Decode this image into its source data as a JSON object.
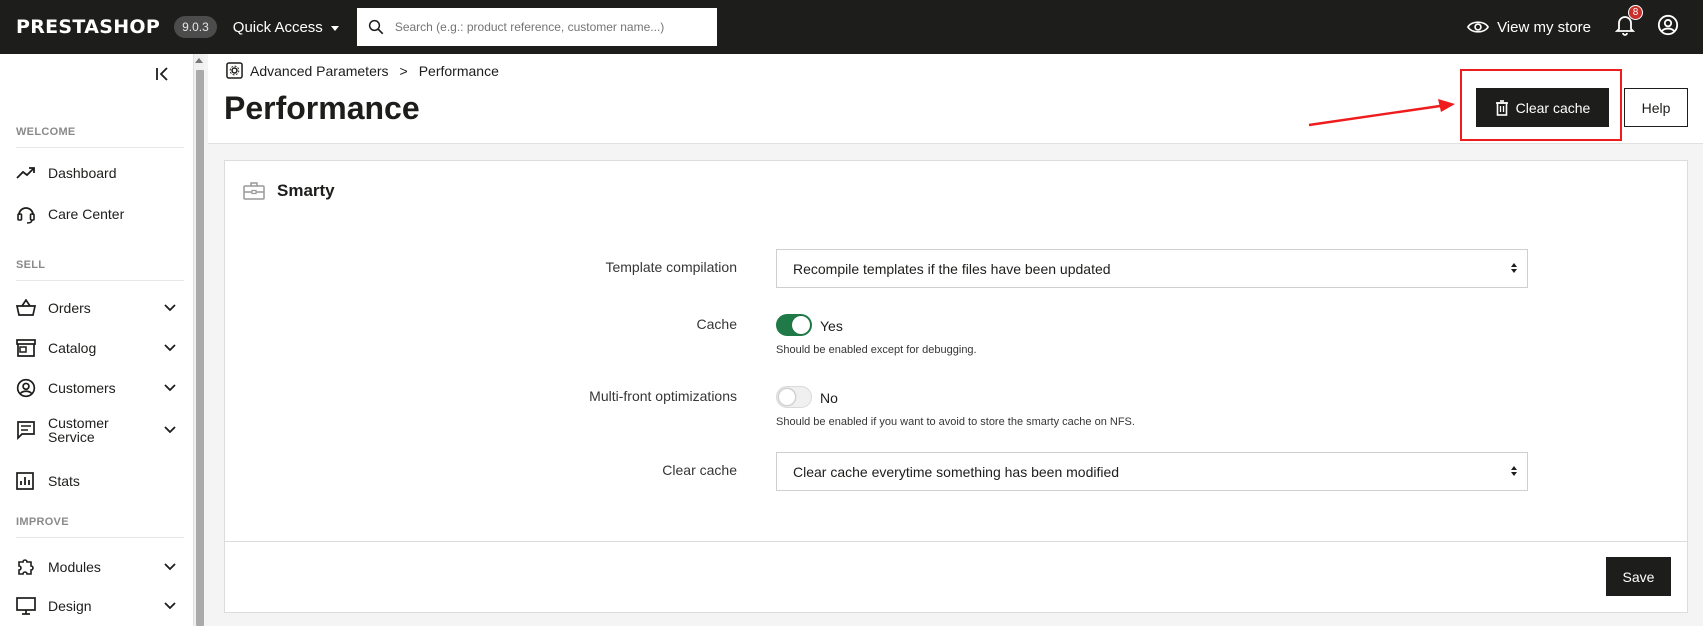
{
  "topbar": {
    "logo": "PRESTASHOP",
    "version": "9.0.3",
    "quick_access": "Quick Access",
    "search_placeholder": "Search (e.g.: product reference, customer name...)",
    "view_store": "View my store",
    "notifications_count": "8"
  },
  "sidebar": {
    "sections": {
      "welcome": "WELCOME",
      "sell": "SELL",
      "improve": "IMPROVE"
    },
    "items": [
      {
        "label": "Dashboard",
        "icon": "trending-up-icon"
      },
      {
        "label": "Care Center",
        "icon": "headset-icon"
      },
      {
        "label": "Orders",
        "icon": "basket-icon"
      },
      {
        "label": "Catalog",
        "icon": "store-icon"
      },
      {
        "label": "Customers",
        "icon": "account-circle-icon"
      },
      {
        "label": "Customer Service",
        "icon": "chat-icon"
      },
      {
        "label": "Stats",
        "icon": "bar-chart-icon"
      },
      {
        "label": "Modules",
        "icon": "puzzle-icon"
      },
      {
        "label": "Design",
        "icon": "monitor-icon"
      }
    ]
  },
  "header": {
    "breadcrumb_parent": "Advanced Parameters",
    "breadcrumb_sep": ">",
    "breadcrumb_current": "Performance",
    "title": "Performance",
    "clear_cache_label": "Clear cache",
    "help_label": "Help"
  },
  "card": {
    "title": "Smarty",
    "fields": {
      "template_compilation": {
        "label": "Template compilation",
        "value": "Recompile templates if the files have been updated"
      },
      "cache": {
        "label": "Cache",
        "state": "Yes",
        "hint": "Should be enabled except for debugging."
      },
      "multi_front": {
        "label": "Multi-front optimizations",
        "state": "No",
        "hint": "Should be enabled if you want to avoid to store the smarty cache on NFS."
      },
      "clear_cache": {
        "label": "Clear cache",
        "value": "Clear cache everytime something has been modified"
      }
    },
    "save_label": "Save"
  },
  "colors": {
    "topbar_bg": "#1d1d1b",
    "toggle_on": "#1f7a47",
    "annotation_red": "#ee1c1c",
    "badge_red": "#c9302c"
  }
}
